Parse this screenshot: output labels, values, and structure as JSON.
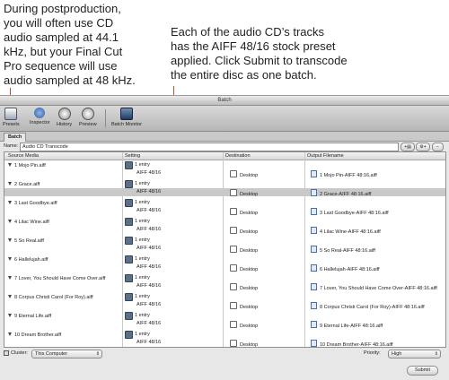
{
  "captions": {
    "left": "During postproduction,\nyou will often use CD\naudio sampled at 44.1\nkHz, but your Final Cut\nPro sequence will use\naudio sampled at 48 kHz.",
    "right": "Each of the audio CD’s tracks\nhas the AIFF 48/16 stock preset\napplied. Click Submit to transcode\nthe entire disc as one batch."
  },
  "window": {
    "title": "Batch"
  },
  "toolbar": {
    "presets": "Presets",
    "inspector": "Inspector",
    "history": "History",
    "preview": "Preview",
    "batch_monitor": "Batch Monitor"
  },
  "tab": {
    "label": "Batch"
  },
  "name_field": {
    "label": "Name:",
    "value": "Audio CD Transcode"
  },
  "columns": {
    "source": "Source Media",
    "setting": "Setting",
    "destination": "Destination",
    "output": "Output Filename"
  },
  "rows": [
    {
      "source": "1 Mojo Pin.aiff",
      "entry": "1 entry",
      "preset": "AIFF 48/16",
      "destination": "Desktop",
      "output": "1 Mojo Pin-AIFF 48:16.aiff"
    },
    {
      "source": "2 Grace.aiff",
      "entry": "1 entry",
      "preset": "AIFF 48/16",
      "destination": "Desktop",
      "output": "2 Grace-AIFF 48:16.aiff"
    },
    {
      "source": "3 Last Goodbye.aiff",
      "entry": "1 entry",
      "preset": "AIFF 48/16",
      "destination": "Desktop",
      "output": "3 Last Goodbye-AIFF 48:16.aiff"
    },
    {
      "source": "4 Lilac Wine.aiff",
      "entry": "1 entry",
      "preset": "AIFF 48/16",
      "destination": "Desktop",
      "output": "4 Lilac Wine-AIFF 48:16.aiff"
    },
    {
      "source": "5 So Real.aiff",
      "entry": "1 entry",
      "preset": "AIFF 48/16",
      "destination": "Desktop",
      "output": "5 So Real-AIFF 48:16.aiff"
    },
    {
      "source": "6 Hallelujah.aiff",
      "entry": "1 entry",
      "preset": "AIFF 48/16",
      "destination": "Desktop",
      "output": "6 Hallelujah-AIFF 48:16.aiff"
    },
    {
      "source": "7 Lover, You Should Have Come Over.aiff",
      "entry": "1 entry",
      "preset": "AIFF 48/16",
      "destination": "Desktop",
      "output": "7 Lover, You Should Have Come Over-AIFF 48:16.aiff"
    },
    {
      "source": "8 Corpus Christi Carol (For Roy).aiff",
      "entry": "1 entry",
      "preset": "AIFF 48/16",
      "destination": "Desktop",
      "output": "8 Corpus Christi Carol (For Roy)-AIFF 48:16.aiff"
    },
    {
      "source": "9 Eternal Life.aiff",
      "entry": "1 entry",
      "preset": "AIFF 48/16",
      "destination": "Desktop",
      "output": "9 Eternal Life-AIFF 48:16.aiff"
    },
    {
      "source": "10 Dream Brother.aiff",
      "entry": "1 entry",
      "preset": "AIFF 48/16",
      "destination": "Desktop",
      "output": "10 Dream Brother-AIFF 48:16.aiff"
    }
  ],
  "cluster": {
    "label": "Cluster:",
    "value": "This Computer"
  },
  "priority": {
    "label": "Priority:",
    "value": "High"
  },
  "submit_label": "Submit",
  "colors": {
    "accent_line": "#d24a2c",
    "selected_row": "#c9c9c9"
  },
  "icons": [
    "presets-icon",
    "inspector-icon",
    "history-icon",
    "preview-icon",
    "batch-monitor-icon",
    "lock-icon"
  ]
}
